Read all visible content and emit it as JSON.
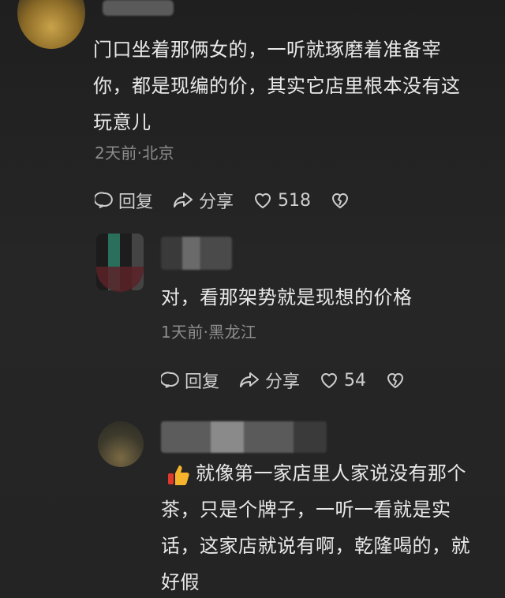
{
  "comments": [
    {
      "content": "门口坐着那俩女的，一听就琢磨着准备宰\n你，都是现编的价，其实它店里根本没有这\n玩意儿",
      "meta": "2天前·北京",
      "reply_label": "回复",
      "share_label": "分享",
      "likes": "518"
    },
    {
      "content": "对，看那架势就是现想的价格",
      "meta": "1天前·黑龙江",
      "reply_label": "回复",
      "share_label": "分享",
      "likes": "54"
    },
    {
      "content": "就像第一家店里人家说没有那个\n茶，只是个牌子，一听一看就是实\n话，这家店就说有啊，乾隆喝的，就\n好假",
      "emoji": "thumbs-up-icon"
    }
  ]
}
